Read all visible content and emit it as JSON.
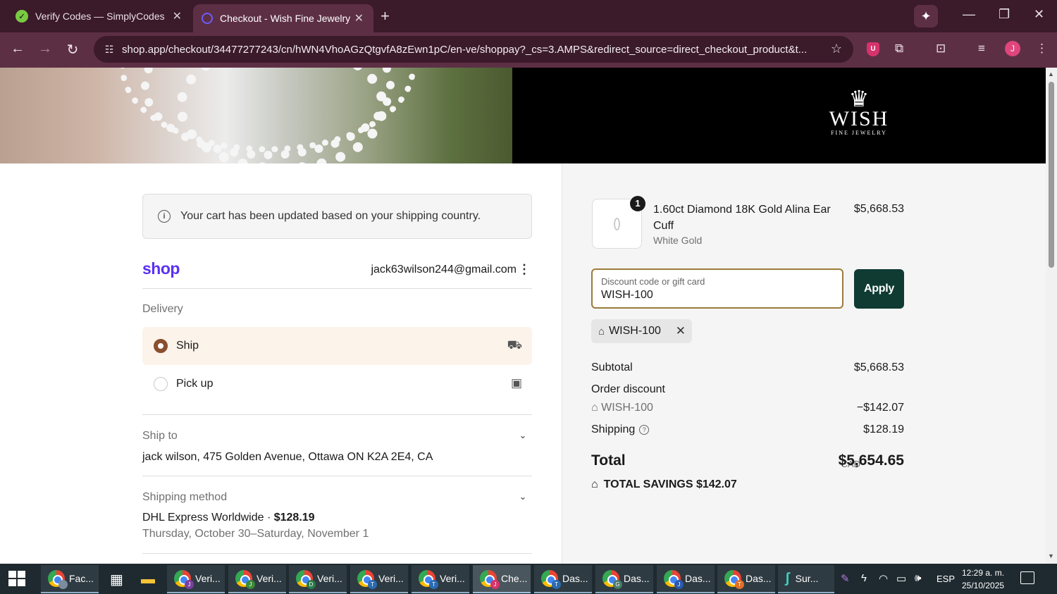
{
  "browser": {
    "tabs": [
      {
        "title": "Verify Codes — SimplyCodes",
        "active": false
      },
      {
        "title": "Checkout - Wish Fine Jewelry",
        "active": true
      }
    ],
    "url": "shop.app/checkout/34477277243/cn/hWN4VhoAGzQtgvfA8zEwn1pC/en-ve/shoppay?_cs=3.AMPS&redirect_source=direct_checkout_product&t...",
    "profile_initial": "J",
    "extension_badge": "U"
  },
  "brand": {
    "logo_main": "WISH",
    "logo_sub": "FINE JEWELRY"
  },
  "checkout": {
    "notice": "Your cart has been updated based on your shipping country.",
    "shop_logo": "shop",
    "email": "jack63wilson244@gmail.com",
    "delivery_label": "Delivery",
    "options": [
      {
        "label": "Ship",
        "selected": true
      },
      {
        "label": "Pick up",
        "selected": false
      }
    ],
    "ship_to_label": "Ship to",
    "ship_to_value": "jack wilson, 475 Golden Avenue, Ottawa ON K2A 2E4, CA",
    "shipping_method_label": "Shipping method",
    "shipping_method_name": "DHL Express Worldwide · ",
    "shipping_method_price": "$128.19",
    "shipping_method_dates": "Thursday, October 30–Saturday, November 1"
  },
  "summary": {
    "product": {
      "quantity": "1",
      "name": "1.60ct Diamond 18K Gold Alina Ear Cuff",
      "variant": "White Gold",
      "price": "$5,668.53"
    },
    "discount_field": {
      "label": "Discount code or gift card",
      "value": "WISH-100"
    },
    "apply_label": "Apply",
    "applied_code": "WISH-100",
    "subtotal_label": "Subtotal",
    "subtotal_value": "$5,668.53",
    "order_discount_label": "Order discount",
    "discount_code": "WISH-100",
    "discount_value": "−$142.07",
    "shipping_label": "Shipping",
    "shipping_value": "$128.19",
    "total_label": "Total",
    "currency": "CAD",
    "total_value": "$5,654.65",
    "savings_label": "TOTAL SAVINGS",
    "savings_value": "$142.07"
  },
  "taskbar": {
    "apps": [
      {
        "label": "Fac...",
        "badge": ""
      },
      {
        "label": "Veri...",
        "badge": "J"
      },
      {
        "label": "Veri...",
        "badge": "J"
      },
      {
        "label": "Veri...",
        "badge": "D"
      },
      {
        "label": "Veri...",
        "badge": "T"
      },
      {
        "label": "Veri...",
        "badge": "T"
      },
      {
        "label": "Che...",
        "badge": "J"
      },
      {
        "label": "Das...",
        "badge": "T"
      },
      {
        "label": "Das...",
        "badge": "G"
      },
      {
        "label": "Das...",
        "badge": "J"
      },
      {
        "label": "Das...",
        "badge": "T"
      },
      {
        "label": "Sur...",
        "badge": ""
      }
    ],
    "language": "ESP",
    "time": "12:29 a. m.",
    "date": "25/10/2025"
  }
}
